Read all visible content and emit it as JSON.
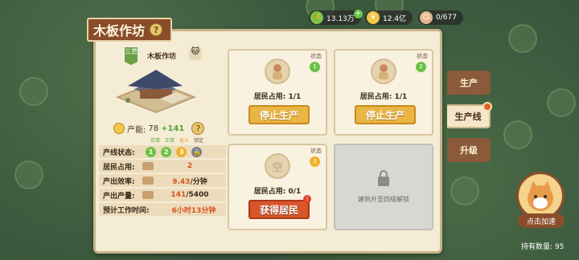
{
  "resources": {
    "food": "13.13万",
    "coins": "12.4亿",
    "residents": "0/677"
  },
  "building": {
    "title": "木板作坊",
    "name": "木板作坊",
    "grade": "三贯",
    "production_label": "产能:",
    "production": "78",
    "bonus": "+141"
  },
  "legend": [
    "正常",
    "正常",
    "无人",
    "锁定"
  ],
  "stats": {
    "line_status_label": "产线状态:",
    "line_status": [
      "1",
      "2",
      "3"
    ],
    "occupancy_label": "居民占用:",
    "occupancy": "2",
    "efficiency_label": "产出效率:",
    "efficiency": "9.43",
    "efficiency_unit": "/分钟",
    "output_label": "产出产量:",
    "output_current": "141",
    "output_total": "/5400",
    "eta_label": "预计工作时间:",
    "eta": "6小时13分钟"
  },
  "lines": [
    {
      "status_label": "状态",
      "status": "1",
      "occupancy": "居民占用: 1/1",
      "button": "停止生产"
    },
    {
      "status_label": "状态",
      "status": "2",
      "occupancy": "居民占用: 1/1",
      "button": "停止生产"
    },
    {
      "status_label": "状态",
      "status": "3",
      "occupancy": "居民占用: 0/1",
      "button": "获得居民",
      "avatar_text": "空"
    }
  ],
  "locked_text": "建筑升至四级解锁",
  "tabs": [
    "生产",
    "生产线",
    "升级"
  ],
  "speed_up": "点击加速",
  "holding": "持有数量: 95",
  "colors": {
    "panel": "#f5ecd6",
    "title": "#8a4d2a",
    "green": "#6bc246",
    "orange": "#d9541e"
  }
}
